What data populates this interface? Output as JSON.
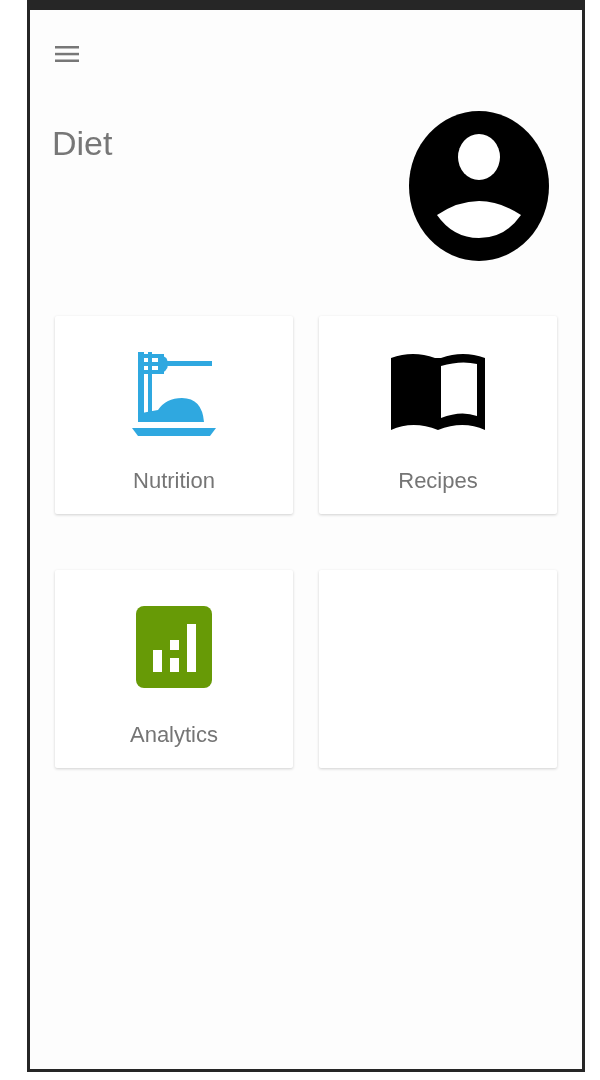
{
  "header": {
    "title": "Diet"
  },
  "tiles": [
    {
      "kind": "nutrition",
      "label": "Nutrition"
    },
    {
      "kind": "recipes",
      "label": "Recipes"
    },
    {
      "kind": "analytics",
      "label": "Analytics"
    },
    {
      "kind": "empty"
    }
  ]
}
